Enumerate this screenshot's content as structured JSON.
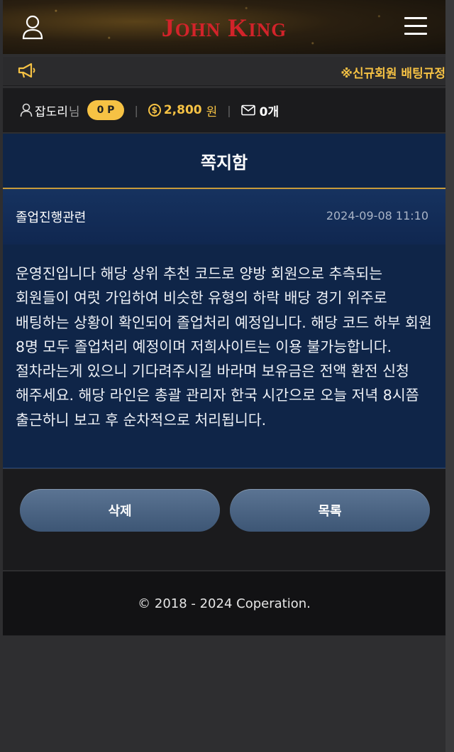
{
  "header": {
    "logo_john": "J",
    "logo_ohn": "OHN",
    "logo_k": "K",
    "logo_ing": "ING"
  },
  "notice": {
    "text": "※신규회원 배팅규정"
  },
  "userbar": {
    "username": "잡도리",
    "honorific": "님",
    "points": "0 P",
    "money": "2,800",
    "money_unit": "원",
    "messages": "0개"
  },
  "page": {
    "title": "쪽지함"
  },
  "message": {
    "subject": "졸업진행관련",
    "date": "2024-09-08 11:10",
    "body": "운영진입니다 해당 상위 추천 코드로 양방 회원으로 추측되는 회원들이 여럿 가입하여 비슷한 유형의 하락 배당 경기 위주로 배팅하는 상황이 확인되어 졸업처리 예정입니다. 해당 코드 하부 회원 8명 모두 졸업처리 예정이며 저희사이트는 이용 불가능합니다. 절차라는게 있으니 기다려주시길 바라며 보유금은 전액 환전 신청 해주세요. 해당 라인은 총괄 관리자 한국 시간으로 오늘 저녁 8시쯤 출근하니 보고 후 순차적으로 처리됩니다."
  },
  "actions": {
    "delete_label": "삭제",
    "list_label": "목록"
  },
  "footer": {
    "copyright": "© 2018 - 2024 Coperation."
  },
  "colors": {
    "accent_gold": "#f6c244",
    "logo_red": "#d2232a",
    "navy": "#0f2548"
  }
}
